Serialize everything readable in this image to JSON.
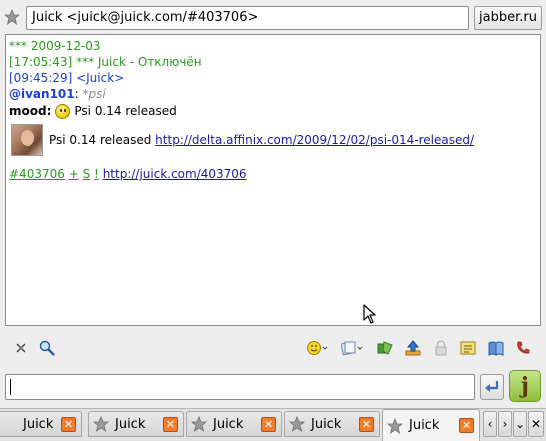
{
  "header": {
    "contact": "Juick <juick@juick.com/#403706>",
    "server": "jabber.ru"
  },
  "chat": {
    "date_line": "*** 2009-12-03",
    "status_line": "[17:05:43] *** Juick - Отключён",
    "msg_header": "[09:45:29] <Juick>",
    "mention_user": "@ivan101",
    "mention_sep": ":",
    "mention_tag": "*psi",
    "mood_label": "mood:",
    "mood_text": "Psi 0.14 released",
    "post_text": "Psi 0.14 released",
    "post_link": "http://delta.affinix.com/2009/12/02/psi-014-released/",
    "tag_id": "#403706",
    "tag_plus": "+",
    "tag_s": "S",
    "tag_bang": "!",
    "tag_link": "http://juick.com/403706"
  },
  "composer": {
    "input_value": "",
    "logo_letter": "j"
  },
  "tabs": [
    {
      "label": "Juick"
    },
    {
      "label": "Juick"
    },
    {
      "label": "Juick"
    },
    {
      "label": "Juick"
    },
    {
      "label": "Juick"
    }
  ],
  "tab_nav": {
    "left": "‹",
    "right": "›",
    "menu": "⌄",
    "close": "✕"
  },
  "colors": {
    "status_green": "#2a9a1c",
    "nick_blue": "#1d3fd6",
    "close_orange": "#f07d2a"
  }
}
